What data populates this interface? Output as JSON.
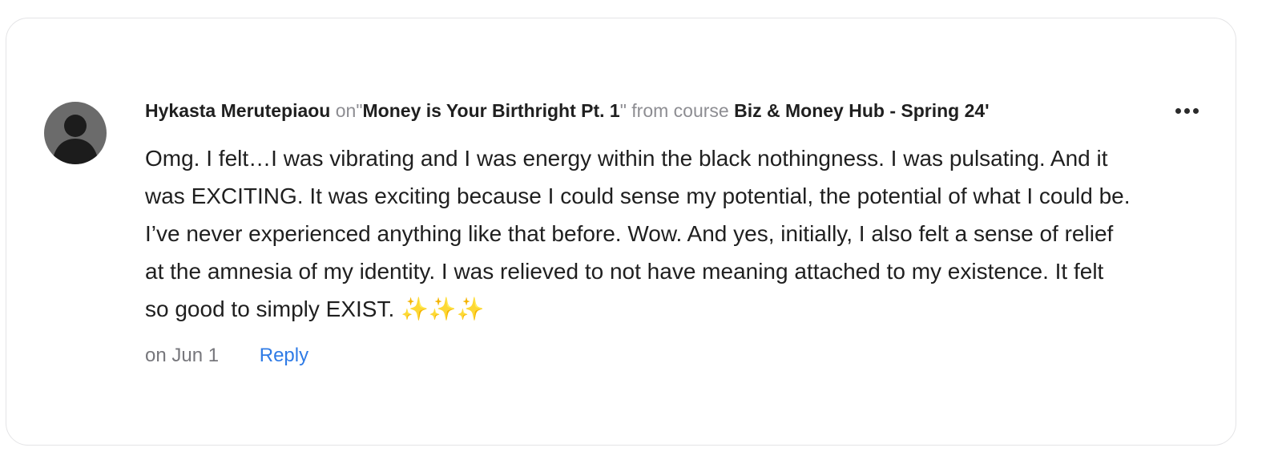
{
  "comment": {
    "author": "Hykasta Merutepiaou",
    "on_label": "on",
    "quote_open": "\"",
    "lesson_title": "Money is Your Birthright Pt. 1",
    "quote_close": "\"",
    "from_label": "from course",
    "course_name": "Biz & Money Hub - Spring 24'",
    "text": "Omg. I felt…I was vibrating and I was energy within the black nothingness. I was pulsating. And it was EXCITING. It was exciting because I could sense my potential, the potential of what I could be. I’ve never experienced anything like that before. Wow. And yes, initially, I also felt a sense of relief at the amnesia of my identity. I was relieved to not have meaning attached to my existence. It felt so good to simply EXIST. ✨✨✨",
    "date": "on Jun 1",
    "reply_label": "Reply",
    "avatar_icon": "user-silhouette-icon",
    "menu_icon": "more-options-icon"
  },
  "colors": {
    "text": "#1f1f1f",
    "muted": "#8d8d92",
    "link": "#2f7be6",
    "border": "#e4e4e6",
    "avatar_bg": "#6b6b6b"
  }
}
